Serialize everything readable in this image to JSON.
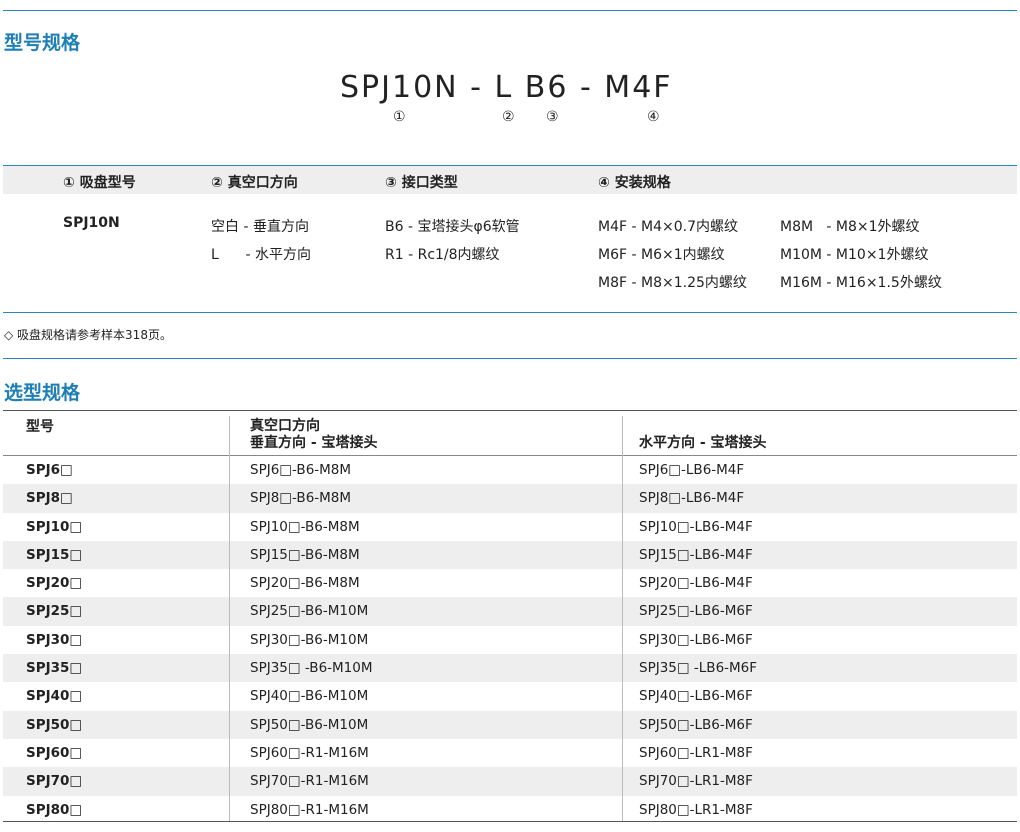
{
  "section1": {
    "title": "型号规格",
    "code": "SPJ10N - L B6 - M4F",
    "markers": [
      "①",
      "②",
      "③",
      "④"
    ],
    "headers": [
      "① 吸盘型号",
      "② 真空口方向",
      "③ 接口类型",
      "④ 安装规格"
    ],
    "model": "SPJ10N",
    "direction": [
      "空白 - 垂直方向",
      "L      - 水平方向"
    ],
    "interface": [
      "B6 - 宝塔接头φ6软管",
      "R1 - Rc1/8内螺纹"
    ],
    "mount_left": [
      "M4F - M4×0.7内螺纹",
      "M6F - M6×1内螺纹",
      "M8F - M8×1.25内螺纹"
    ],
    "mount_right": [
      "M8M   - M8×1外螺纹",
      "M10M - M10×1外螺纹",
      "M16M - M16×1.5外螺纹"
    ],
    "note": "◇ 吸盘规格请参考样本318页。"
  },
  "section2": {
    "title": "选型规格",
    "col_model": "型号",
    "col_group": "真空口方向",
    "col_vertical": "垂直方向 - 宝塔接头",
    "col_horizontal": "水平方向 - 宝塔接头",
    "rows": [
      {
        "model": "SPJ6□",
        "vertical": "SPJ6□-B6-M8M",
        "horizontal": "SPJ6□-LB6-M4F"
      },
      {
        "model": "SPJ8□",
        "vertical": "SPJ8□-B6-M8M",
        "horizontal": "SPJ8□-LB6-M4F"
      },
      {
        "model": "SPJ10□",
        "vertical": "SPJ10□-B6-M8M",
        "horizontal": "SPJ10□-LB6-M4F"
      },
      {
        "model": "SPJ15□",
        "vertical": "SPJ15□-B6-M8M",
        "horizontal": "SPJ15□-LB6-M4F"
      },
      {
        "model": "SPJ20□",
        "vertical": "SPJ20□-B6-M8M",
        "horizontal": "SPJ20□-LB6-M4F"
      },
      {
        "model": "SPJ25□",
        "vertical": "SPJ25□-B6-M10M",
        "horizontal": "SPJ25□-LB6-M6F"
      },
      {
        "model": "SPJ30□",
        "vertical": "SPJ30□-B6-M10M",
        "horizontal": "SPJ30□-LB6-M6F"
      },
      {
        "model": "SPJ35□",
        "vertical": "SPJ35□ -B6-M10M",
        "horizontal": "SPJ35□ -LB6-M6F"
      },
      {
        "model": "SPJ40□",
        "vertical": "SPJ40□-B6-M10M",
        "horizontal": "SPJ40□-LB6-M6F"
      },
      {
        "model": "SPJ50□",
        "vertical": "SPJ50□-B6-M10M",
        "horizontal": "SPJ50□-LB6-M6F"
      },
      {
        "model": "SPJ60□",
        "vertical": "SPJ60□-R1-M16M",
        "horizontal": "SPJ60□-LR1-M8F"
      },
      {
        "model": "SPJ70□",
        "vertical": "SPJ70□-R1-M16M",
        "horizontal": "SPJ70□-LR1-M8F"
      },
      {
        "model": "SPJ80□",
        "vertical": "SPJ80□-R1-M16M",
        "horizontal": "SPJ80□-LR1-M8F"
      }
    ]
  }
}
